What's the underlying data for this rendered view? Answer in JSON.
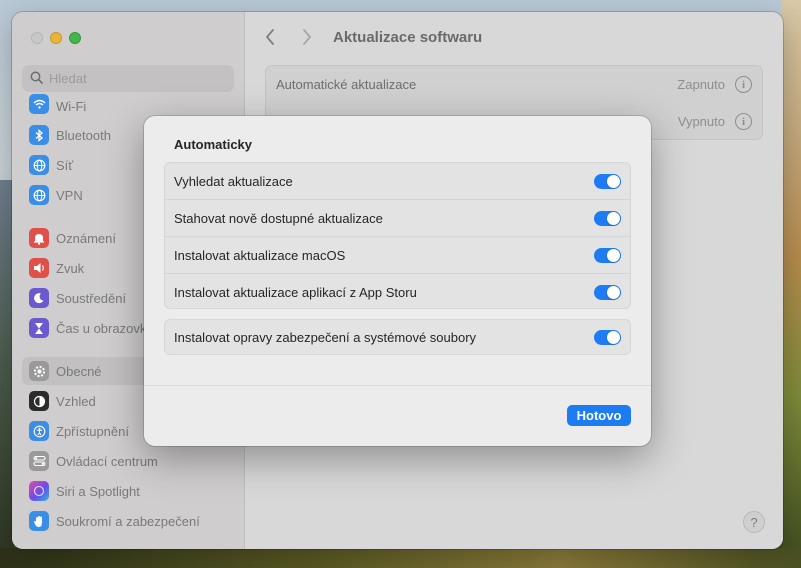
{
  "window": {
    "title": "Aktualizace softwaru"
  },
  "sidebar": {
    "search_placeholder": "Hledat",
    "items": [
      {
        "label": "Wi‑Fi",
        "icon": "wifi-icon",
        "color": "#3b8ee6"
      },
      {
        "label": "Bluetooth",
        "icon": "bluetooth-icon",
        "color": "#3b8ee6"
      },
      {
        "label": "Síť",
        "icon": "globe-icon",
        "color": "#3b8ee6"
      },
      {
        "label": "VPN",
        "icon": "vpn-globe-icon",
        "color": "#3b8ee6"
      },
      {
        "label": "Oznámení",
        "icon": "bell-icon",
        "color": "#e0504a"
      },
      {
        "label": "Zvuk",
        "icon": "speaker-icon",
        "color": "#e0504a"
      },
      {
        "label": "Soustředění",
        "icon": "moon-icon",
        "color": "#6a5acd"
      },
      {
        "label": "Čas u obrazovky",
        "icon": "hourglass-icon",
        "color": "#6a5acd"
      },
      {
        "label": "Obecné",
        "icon": "gear-icon",
        "color": "#9a9a9a"
      },
      {
        "label": "Vzhled",
        "icon": "appearance-icon",
        "color": "#2b2b2b"
      },
      {
        "label": "Zpřístupnění",
        "icon": "accessibility-icon",
        "color": "#3b8ee6"
      },
      {
        "label": "Ovládací centrum",
        "icon": "control-center-icon",
        "color": "#9a9a9a"
      },
      {
        "label": "Siri a Spotlight",
        "icon": "siri-icon",
        "color": "#7a4ad6"
      },
      {
        "label": "Soukromí a zabezpečení",
        "icon": "hand-icon",
        "color": "#3b8ee6"
      }
    ]
  },
  "main": {
    "rows": [
      {
        "label": "Automatické aktualizace",
        "value": "Zapnuto"
      },
      {
        "label": "",
        "value": "Vypnuto"
      }
    ],
    "help_label": "?"
  },
  "dialog": {
    "title": "Automaticky",
    "group_a": [
      {
        "label": "Vyhledat aktualizace",
        "on": true
      },
      {
        "label": "Stahovat nově dostupné aktualizace",
        "on": true
      },
      {
        "label": "Instalovat aktualizace macOS",
        "on": true
      },
      {
        "label": "Instalovat aktualizace aplikací z App Storu",
        "on": true
      }
    ],
    "group_b": [
      {
        "label": "Instalovat opravy zabezpečení a systémové soubory",
        "on": true
      }
    ],
    "done_label": "Hotovo"
  },
  "colors": {
    "accent": "#1e7cf2"
  }
}
